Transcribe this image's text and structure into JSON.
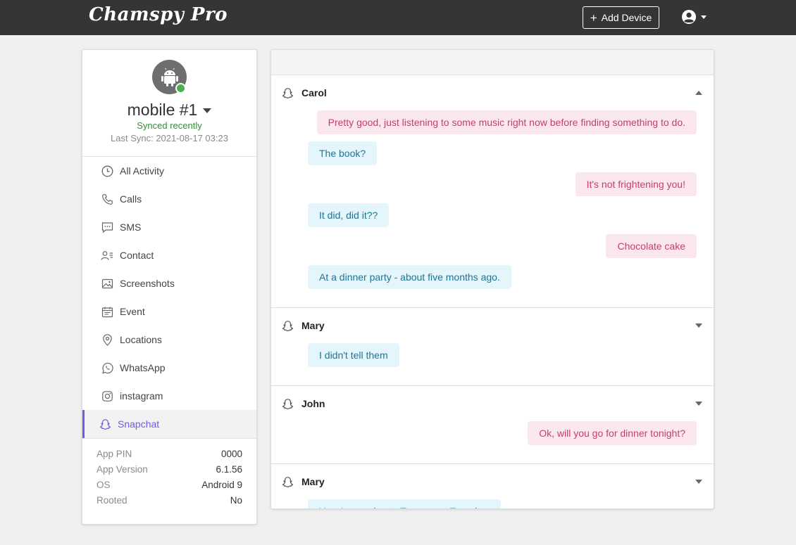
{
  "app": {
    "brand": "Chamspy Pro",
    "add_device_label": "Add Device"
  },
  "device": {
    "name": "mobile #1",
    "sync_status": "Synced recently",
    "last_sync": "Last Sync: 2021-08-17 03:23",
    "online": true
  },
  "nav": [
    {
      "label": "All Activity",
      "icon": "clock-icon"
    },
    {
      "label": "Calls",
      "icon": "phone-icon"
    },
    {
      "label": "SMS",
      "icon": "chat-icon"
    },
    {
      "label": "Contact",
      "icon": "contact-icon"
    },
    {
      "label": "Screenshots",
      "icon": "image-icon"
    },
    {
      "label": "Event",
      "icon": "calendar-icon"
    },
    {
      "label": "Locations",
      "icon": "location-pin-icon"
    },
    {
      "label": "WhatsApp",
      "icon": "whatsapp-icon"
    },
    {
      "label": "instagram",
      "icon": "instagram-icon"
    },
    {
      "label": "Snapchat",
      "icon": "snapchat-icon",
      "active": true
    }
  ],
  "info": [
    {
      "label": "App PIN",
      "value": "0000"
    },
    {
      "label": "App Version",
      "value": "6.1.56"
    },
    {
      "label": "OS",
      "value": "Android 9"
    },
    {
      "label": "Rooted",
      "value": "No"
    }
  ],
  "conversations": [
    {
      "name": "Carol",
      "expanded": true,
      "messages": [
        {
          "dir": "out",
          "text": "Pretty good, just listening to some music right now before finding something to do."
        },
        {
          "dir": "in",
          "text": "The book?"
        },
        {
          "dir": "out",
          "text": "It's not frightening you!"
        },
        {
          "dir": "in",
          "text": "It did, did it??"
        },
        {
          "dir": "out",
          "text": "Chocolate cake"
        },
        {
          "dir": "in",
          "text": "At a dinner party - about five months ago."
        }
      ]
    },
    {
      "name": "Mary",
      "expanded": false,
      "messages": [
        {
          "dir": "in",
          "text": "I didn't tell them"
        }
      ]
    },
    {
      "name": "John",
      "expanded": false,
      "messages": [
        {
          "dir": "out",
          "text": "Ok, will you go for dinner tonight?"
        }
      ]
    },
    {
      "name": "Mary",
      "expanded": false,
      "messages": [
        {
          "dir": "in",
          "text": "Yes, I am going to Texas next Tuesday."
        }
      ]
    }
  ],
  "colors": {
    "topbar": "#353535",
    "accent": "#6c5ce7",
    "online": "#4caf50",
    "incoming_bg": "#e4f5fc",
    "incoming_text": "#1f7591",
    "outgoing_bg": "#fbe8ee",
    "outgoing_text": "#c2406b"
  }
}
